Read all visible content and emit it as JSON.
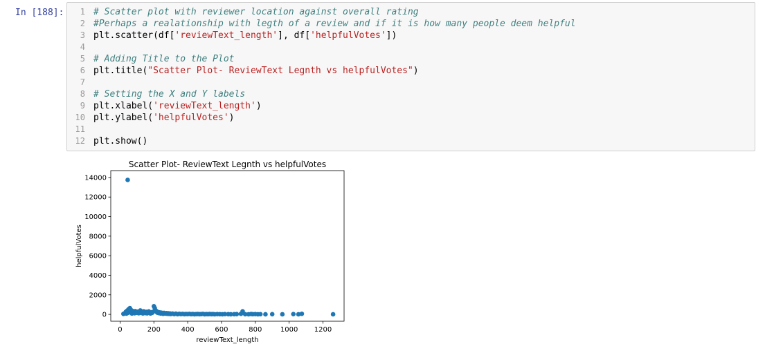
{
  "cell": {
    "prompt": "In [188]:",
    "lines": [
      {
        "n": "1",
        "parts": [
          {
            "t": "# Scatter plot with reviewer location against overall rating",
            "c": "cm"
          }
        ]
      },
      {
        "n": "2",
        "parts": [
          {
            "t": "#Perhaps a realationship with legth of a review and if it is how many people deem helpful",
            "c": "cm"
          }
        ]
      },
      {
        "n": "3",
        "parts": [
          {
            "t": "plt.scatter(df[",
            "c": ""
          },
          {
            "t": "'reviewText_length'",
            "c": "st"
          },
          {
            "t": "], df[",
            "c": ""
          },
          {
            "t": "'helpfulVotes'",
            "c": "st"
          },
          {
            "t": "])",
            "c": ""
          }
        ]
      },
      {
        "n": "4",
        "parts": []
      },
      {
        "n": "5",
        "parts": [
          {
            "t": "# Adding Title to the Plot",
            "c": "cm"
          }
        ]
      },
      {
        "n": "6",
        "parts": [
          {
            "t": "plt.title(",
            "c": ""
          },
          {
            "t": "\"Scatter Plot- ReviewText Legnth vs helpfulVotes\"",
            "c": "st"
          },
          {
            "t": ")",
            "c": ""
          }
        ]
      },
      {
        "n": "7",
        "parts": []
      },
      {
        "n": "8",
        "parts": [
          {
            "t": "# Setting the X and Y labels",
            "c": "cm"
          }
        ]
      },
      {
        "n": "9",
        "parts": [
          {
            "t": "plt.xlabel(",
            "c": ""
          },
          {
            "t": "'reviewText_length'",
            "c": "st"
          },
          {
            "t": ")",
            "c": ""
          }
        ]
      },
      {
        "n": "10",
        "parts": [
          {
            "t": "plt.ylabel(",
            "c": ""
          },
          {
            "t": "'helpfulVotes'",
            "c": "st"
          },
          {
            "t": ")",
            "c": ""
          }
        ]
      },
      {
        "n": "11",
        "parts": []
      },
      {
        "n": "12",
        "parts": [
          {
            "t": "plt.show()",
            "c": ""
          }
        ]
      }
    ]
  },
  "chart_data": {
    "type": "scatter",
    "title": "Scatter Plot- ReviewText Legnth vs helpfulVotes",
    "xlabel": "reviewText_length",
    "ylabel": "helpfulVotes",
    "xlim": [
      -55,
      1325
    ],
    "ylim": [
      -700,
      14700
    ],
    "xticks": [
      0,
      200,
      400,
      600,
      800,
      1000,
      1200
    ],
    "yticks": [
      0,
      2000,
      4000,
      6000,
      8000,
      10000,
      12000,
      14000
    ],
    "grid": false,
    "color": "#1f77b4",
    "points": [
      [
        45,
        13750
      ],
      [
        20,
        50
      ],
      [
        28,
        120
      ],
      [
        34,
        260
      ],
      [
        38,
        80
      ],
      [
        42,
        380
      ],
      [
        46,
        150
      ],
      [
        50,
        520
      ],
      [
        54,
        300
      ],
      [
        58,
        640
      ],
      [
        62,
        210
      ],
      [
        66,
        430
      ],
      [
        70,
        90
      ],
      [
        74,
        350
      ],
      [
        78,
        180
      ],
      [
        82,
        270
      ],
      [
        86,
        120
      ],
      [
        90,
        330
      ],
      [
        95,
        200
      ],
      [
        100,
        160
      ],
      [
        105,
        280
      ],
      [
        110,
        120
      ],
      [
        115,
        240
      ],
      [
        120,
        400
      ],
      [
        125,
        150
      ],
      [
        130,
        220
      ],
      [
        135,
        100
      ],
      [
        140,
        310
      ],
      [
        145,
        170
      ],
      [
        150,
        130
      ],
      [
        155,
        260
      ],
      [
        160,
        110
      ],
      [
        165,
        190
      ],
      [
        170,
        300
      ],
      [
        175,
        140
      ],
      [
        180,
        90
      ],
      [
        185,
        210
      ],
      [
        190,
        160
      ],
      [
        195,
        260
      ],
      [
        200,
        830
      ],
      [
        205,
        650
      ],
      [
        210,
        420
      ],
      [
        215,
        300
      ],
      [
        220,
        180
      ],
      [
        225,
        240
      ],
      [
        230,
        130
      ],
      [
        235,
        200
      ],
      [
        240,
        90
      ],
      [
        245,
        170
      ],
      [
        250,
        120
      ],
      [
        255,
        60
      ],
      [
        260,
        150
      ],
      [
        265,
        100
      ],
      [
        270,
        80
      ],
      [
        275,
        130
      ],
      [
        280,
        60
      ],
      [
        285,
        110
      ],
      [
        290,
        50
      ],
      [
        295,
        90
      ],
      [
        300,
        40
      ],
      [
        310,
        80
      ],
      [
        320,
        30
      ],
      [
        330,
        70
      ],
      [
        340,
        20
      ],
      [
        350,
        60
      ],
      [
        360,
        30
      ],
      [
        370,
        50
      ],
      [
        380,
        20
      ],
      [
        390,
        40
      ],
      [
        400,
        30
      ],
      [
        410,
        50
      ],
      [
        420,
        20
      ],
      [
        430,
        40
      ],
      [
        440,
        10
      ],
      [
        450,
        30
      ],
      [
        460,
        40
      ],
      [
        470,
        20
      ],
      [
        480,
        30
      ],
      [
        490,
        50
      ],
      [
        500,
        10
      ],
      [
        510,
        30
      ],
      [
        520,
        20
      ],
      [
        530,
        40
      ],
      [
        540,
        20
      ],
      [
        550,
        30
      ],
      [
        560,
        10
      ],
      [
        575,
        30
      ],
      [
        590,
        20
      ],
      [
        605,
        10
      ],
      [
        620,
        30
      ],
      [
        640,
        20
      ],
      [
        655,
        10
      ],
      [
        675,
        20
      ],
      [
        690,
        30
      ],
      [
        715,
        60
      ],
      [
        725,
        310
      ],
      [
        740,
        20
      ],
      [
        760,
        10
      ],
      [
        775,
        40
      ],
      [
        785,
        20
      ],
      [
        800,
        30
      ],
      [
        815,
        10
      ],
      [
        830,
        20
      ],
      [
        860,
        10
      ],
      [
        900,
        20
      ],
      [
        960,
        10
      ],
      [
        1025,
        30
      ],
      [
        1055,
        10
      ],
      [
        1075,
        60
      ],
      [
        1260,
        10
      ]
    ]
  }
}
